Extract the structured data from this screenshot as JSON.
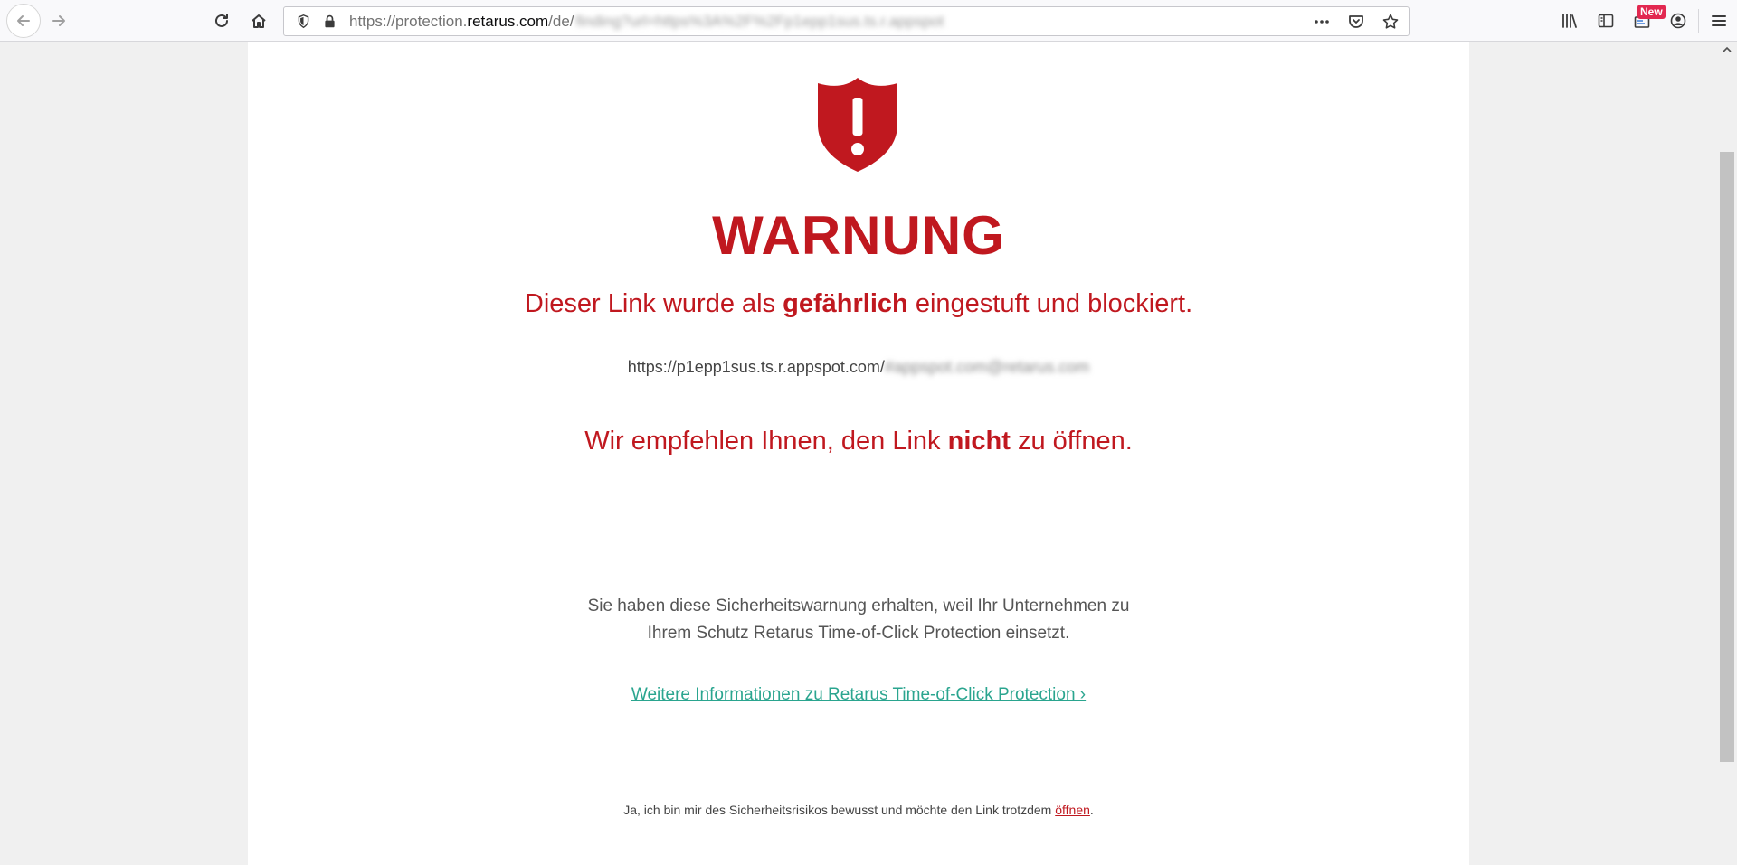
{
  "browser": {
    "url_prefix": "https://protection.",
    "url_domain": "retarus.com",
    "url_path": "/de/",
    "url_blurred": "finding?url=https%3A%2F%2Fp1epp1sus.ts.r.appspot",
    "new_badge": "New"
  },
  "warning": {
    "title": "WARNUNG",
    "subtitle_pre": "Dieser Link wurde als ",
    "subtitle_bold": "gefährlich",
    "subtitle_post": " eingestuft und blockiert.",
    "blocked_url": "https://p1epp1sus.ts.r.appspot.com/",
    "blocked_url_blurred": "#appspot.com@retarus.com",
    "recommend_pre": "Wir empfehlen Ihnen, den Link ",
    "recommend_bold": "nicht",
    "recommend_post": " zu öffnen.",
    "info_line1": "Sie haben diese Sicherheitswarnung erhalten, weil Ihr Unternehmen zu",
    "info_line2": "Ihrem Schutz Retarus Time-of-Click Protection einsetzt.",
    "more_info_link": "Weitere Informationen zu Retarus Time-of-Click Protection ›",
    "risk_note": "Ja, ich bin mir des Sicherheitsrisikos bewusst und möchte den Link trotzdem ",
    "risk_link": "öffnen",
    "risk_note_end": "."
  },
  "colors": {
    "warning_red": "#c0181f",
    "link_teal": "#2aa58f"
  },
  "icons": {
    "shield": "shield-exclamation-icon"
  }
}
